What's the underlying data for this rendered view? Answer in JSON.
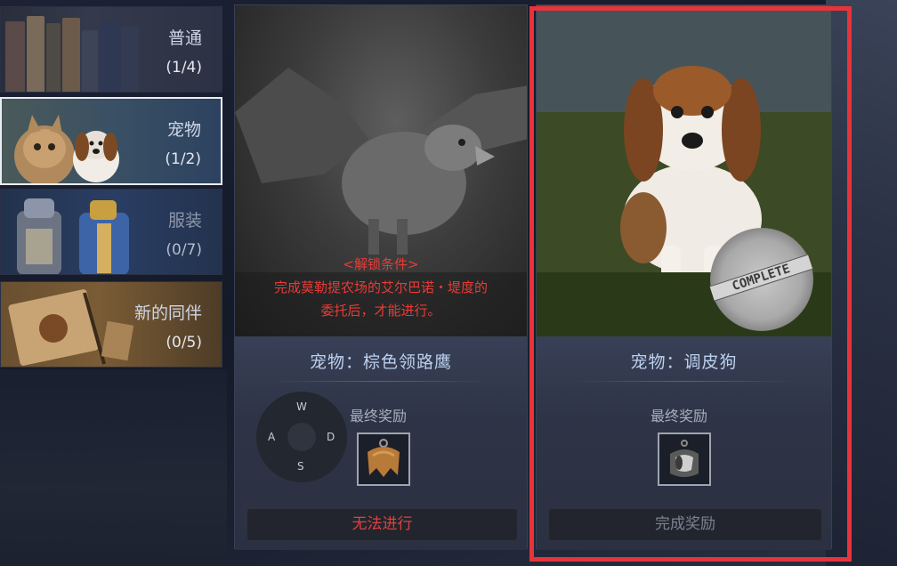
{
  "sidebar": {
    "items": [
      {
        "label": "普通",
        "count": "(1/4)"
      },
      {
        "label": "宠物",
        "count": "(1/2)"
      },
      {
        "label": "服装",
        "count": "(0/7)"
      },
      {
        "label": "新的同伴",
        "count": "(0/5)"
      }
    ]
  },
  "cards": [
    {
      "title": "宠物：棕色领路鹰",
      "unlock_line1": "<解锁条件>",
      "unlock_line2": "完成莫勒提农场的艾尔巴诺・堤度的",
      "unlock_line3": "委托后，才能进行。",
      "reward_label": "最终奖励",
      "reward_icon": "leather-cape-icon",
      "action_label": "无法进行"
    },
    {
      "title": "宠物：调皮狗",
      "stamp": "COMPLETE",
      "reward_label": "最终奖励",
      "reward_icon": "dog-helmet-icon",
      "action_label": "完成奖励"
    }
  ],
  "joystick": {
    "up": "W",
    "left": "A",
    "right": "D",
    "down": "S"
  },
  "colors": {
    "highlight": "#e8333b",
    "title": "#bcd0ee",
    "unavailable": "#e0413c",
    "selected_border": "#e9edf4"
  }
}
